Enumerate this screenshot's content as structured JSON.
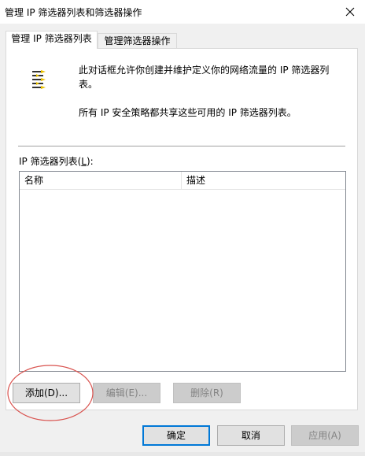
{
  "window": {
    "title": "管理 IP 筛选器列表和筛选器操作"
  },
  "tabs": [
    {
      "label": "管理 IP 筛选器列表",
      "active": true
    },
    {
      "label": "管理筛选器操作",
      "active": false
    }
  ],
  "panel": {
    "description_line1": "此对话框允许你创建并维护定义你的网络流量的 IP 筛选器列",
    "description_line2": "表。",
    "description_line3": "所有 IP 安全策略都共享这些可用的 IP 筛选器列表。",
    "list_label_prefix": "IP 筛选器列表(",
    "list_label_key": "L",
    "list_label_suffix": "):",
    "columns": [
      "名称",
      "描述"
    ],
    "rows": [],
    "buttons": {
      "add": "添加(D)...",
      "edit": "编辑(E)...",
      "delete": "删除(R)"
    }
  },
  "footer": {
    "ok": "确定",
    "cancel": "取消",
    "apply": "应用(A)"
  },
  "icons": {
    "close": "close-icon",
    "filter": "ip-filter-list-icon"
  },
  "colors": {
    "annotation": "#d9534f",
    "default_button_border": "#0078d7"
  }
}
